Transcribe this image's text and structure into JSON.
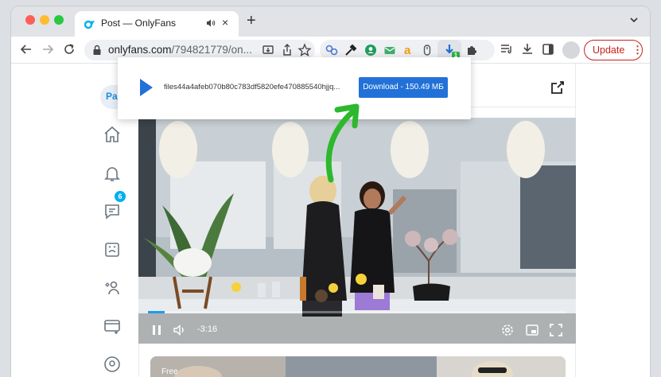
{
  "browser": {
    "tab": {
      "title": "Post — OnlyFans",
      "audio_icon": "speaker-icon",
      "close_label": "×"
    },
    "new_tab_label": "+",
    "url_host": "onlyfans.com",
    "url_path": "/794821779/on...",
    "update_label": "Update",
    "update_menu_label": "⋮",
    "extension_badge": "1"
  },
  "sidebar": {
    "profile_short": "Pa",
    "messages_badge": "6",
    "items": [
      "home-icon",
      "bell-icon",
      "messages-icon",
      "collections-icon",
      "subscriptions-icon",
      "card-icon",
      "profile-icon"
    ]
  },
  "video": {
    "time_remaining": "-3:16",
    "progress_fraction": 0.04
  },
  "next_post": {
    "label": "Free"
  },
  "download_popup": {
    "filename": "files44a4afeb070b80c783df5820efe470885540hjjq...",
    "button_label": "Download - 150.49 МБ"
  },
  "colors": {
    "accent": "#00aff0",
    "download_button": "#2271d8",
    "update_red": "#c5221f",
    "annotation_arrow": "#2db82d"
  }
}
